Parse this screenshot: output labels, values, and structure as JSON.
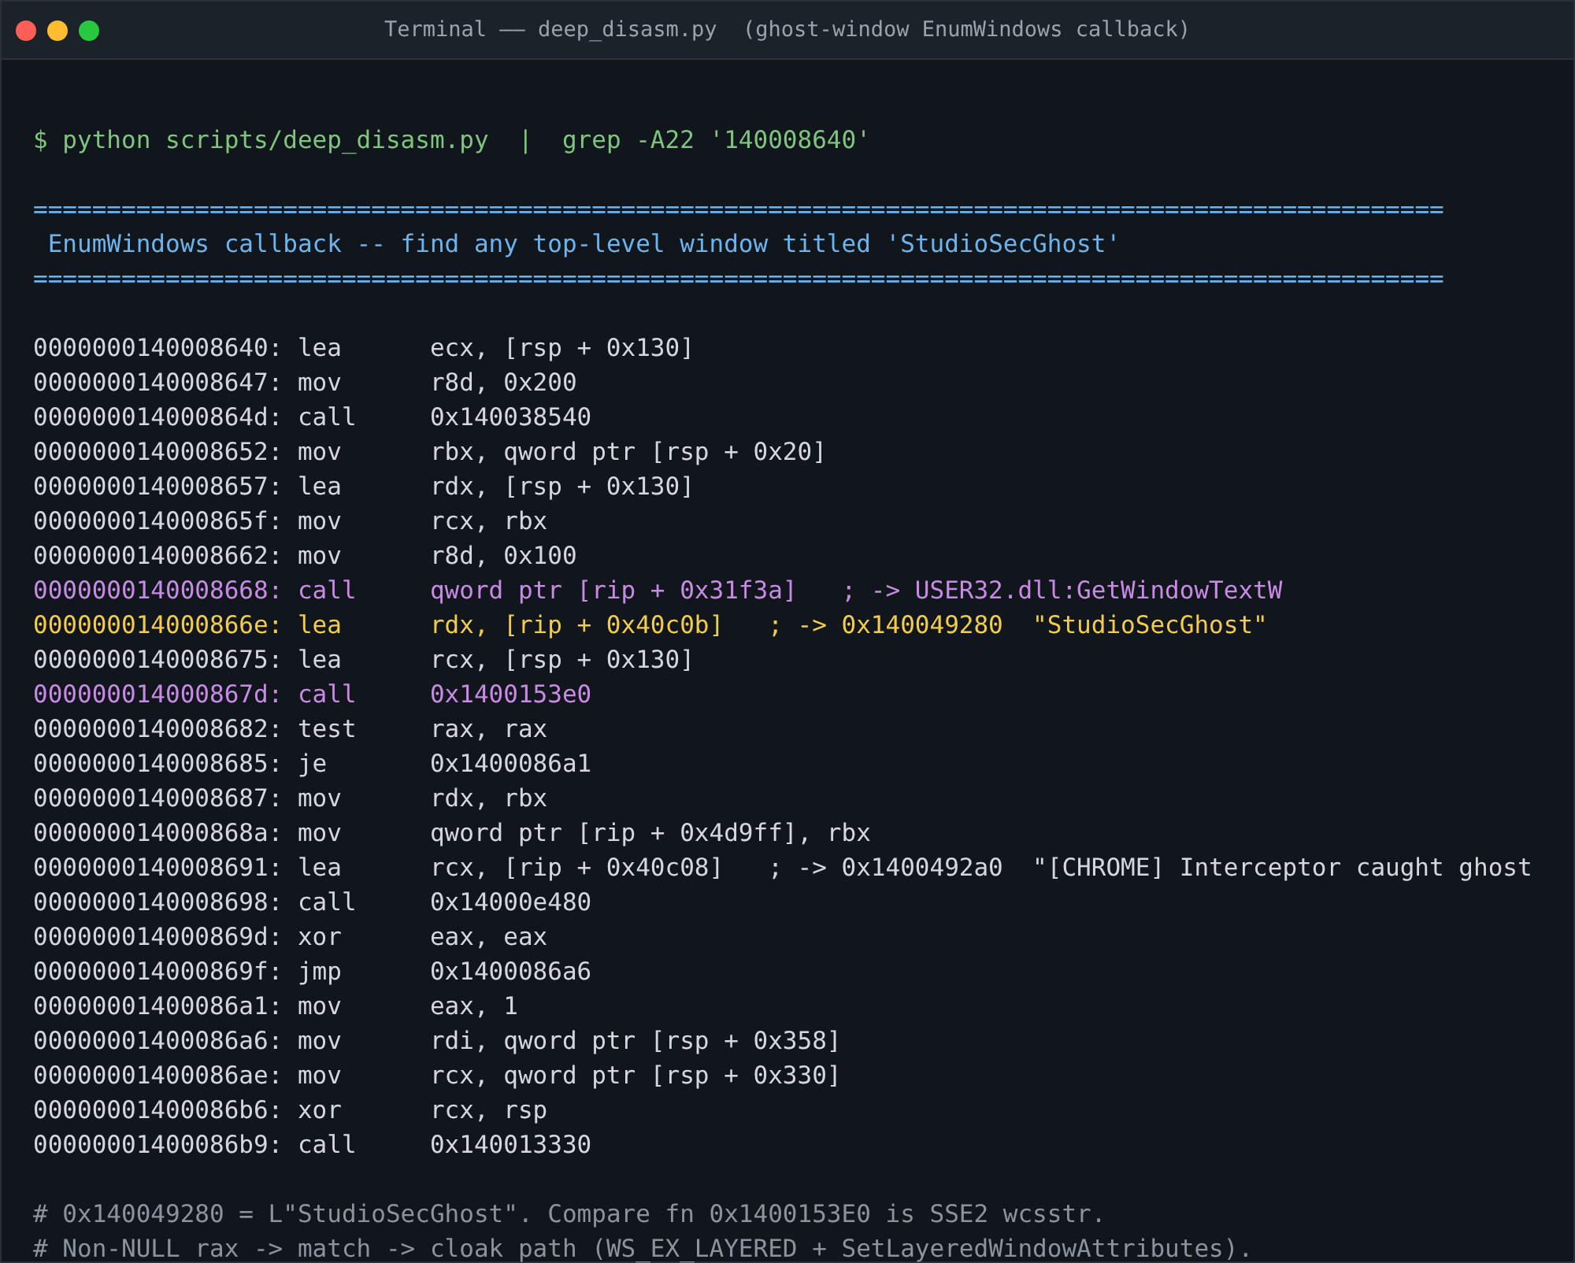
{
  "window": {
    "title": "Terminal —— deep_disasm.py  (ghost-window EnumWindows callback)"
  },
  "prompt": "$ python scripts/deep_disasm.py  |  grep -A22 '140008640'",
  "banner": {
    "rule_top": "================================================================================================",
    "heading": " EnumWindows callback -- find any top-level window titled 'StudioSecGhost'",
    "rule_bottom": "================================================================================================"
  },
  "lines": [
    {
      "kind": "plain",
      "address": "0000000140008640:",
      "mnemonic": "lea",
      "operands": "ecx, [rsp + 0x130]"
    },
    {
      "kind": "plain",
      "address": "0000000140008647:",
      "mnemonic": "mov",
      "operands": "r8d, 0x200"
    },
    {
      "kind": "plain",
      "address": "000000014000864d:",
      "mnemonic": "call",
      "operands": "0x140038540"
    },
    {
      "kind": "plain",
      "address": "0000000140008652:",
      "mnemonic": "mov",
      "operands": "rbx, qword ptr [rsp + 0x20]"
    },
    {
      "kind": "plain",
      "address": "0000000140008657:",
      "mnemonic": "lea",
      "operands": "rdx, [rsp + 0x130]"
    },
    {
      "kind": "plain",
      "address": "000000014000865f:",
      "mnemonic": "mov",
      "operands": "rcx, rbx"
    },
    {
      "kind": "plain",
      "address": "0000000140008662:",
      "mnemonic": "mov",
      "operands": "r8d, 0x100"
    },
    {
      "kind": "call",
      "address": "0000000140008668:",
      "mnemonic": "call",
      "operands": "qword ptr [rip + 0x31f3a]   ; -> USER32.dll:GetWindowTextW"
    },
    {
      "kind": "ref",
      "address": "000000014000866e:",
      "mnemonic": "lea",
      "operands": "rdx, [rip + 0x40c0b]   ; -> 0x140049280  \"StudioSecGhost\""
    },
    {
      "kind": "plain",
      "address": "0000000140008675:",
      "mnemonic": "lea",
      "operands": "rcx, [rsp + 0x130]"
    },
    {
      "kind": "call",
      "address": "000000014000867d:",
      "mnemonic": "call",
      "operands": "0x1400153e0"
    },
    {
      "kind": "plain",
      "address": "0000000140008682:",
      "mnemonic": "test",
      "operands": "rax, rax"
    },
    {
      "kind": "plain",
      "address": "0000000140008685:",
      "mnemonic": "je",
      "operands": "0x1400086a1"
    },
    {
      "kind": "plain",
      "address": "0000000140008687:",
      "mnemonic": "mov",
      "operands": "rdx, rbx"
    },
    {
      "kind": "plain",
      "address": "000000014000868a:",
      "mnemonic": "mov",
      "operands": "qword ptr [rip + 0x4d9ff], rbx"
    },
    {
      "kind": "plain",
      "address": "0000000140008691:",
      "mnemonic": "lea",
      "operands": "rcx, [rip + 0x40c08]   ; -> 0x1400492a0  \"[CHROME] Interceptor caught ghost"
    },
    {
      "kind": "plain",
      "address": "0000000140008698:",
      "mnemonic": "call",
      "operands": "0x14000e480"
    },
    {
      "kind": "plain",
      "address": "000000014000869d:",
      "mnemonic": "xor",
      "operands": "eax, eax"
    },
    {
      "kind": "plain",
      "address": "000000014000869f:",
      "mnemonic": "jmp",
      "operands": "0x1400086a6"
    },
    {
      "kind": "plain",
      "address": "00000001400086a1:",
      "mnemonic": "mov",
      "operands": "eax, 1"
    },
    {
      "kind": "plain",
      "address": "00000001400086a6:",
      "mnemonic": "mov",
      "operands": "rdi, qword ptr [rsp + 0x358]"
    },
    {
      "kind": "plain",
      "address": "00000001400086ae:",
      "mnemonic": "mov",
      "operands": "rcx, qword ptr [rsp + 0x330]"
    },
    {
      "kind": "plain",
      "address": "00000001400086b6:",
      "mnemonic": "xor",
      "operands": "rcx, rsp"
    },
    {
      "kind": "plain",
      "address": "00000001400086b9:",
      "mnemonic": "call",
      "operands": "0x140013330"
    }
  ],
  "comments": [
    "# 0x140049280 = L\"StudioSecGhost\". Compare fn 0x1400153E0 is SSE2 wcsstr.",
    "# Non-NULL rax -> match -> cloak path (WS_EX_LAYERED + SetLayeredWindowAttributes)."
  ]
}
